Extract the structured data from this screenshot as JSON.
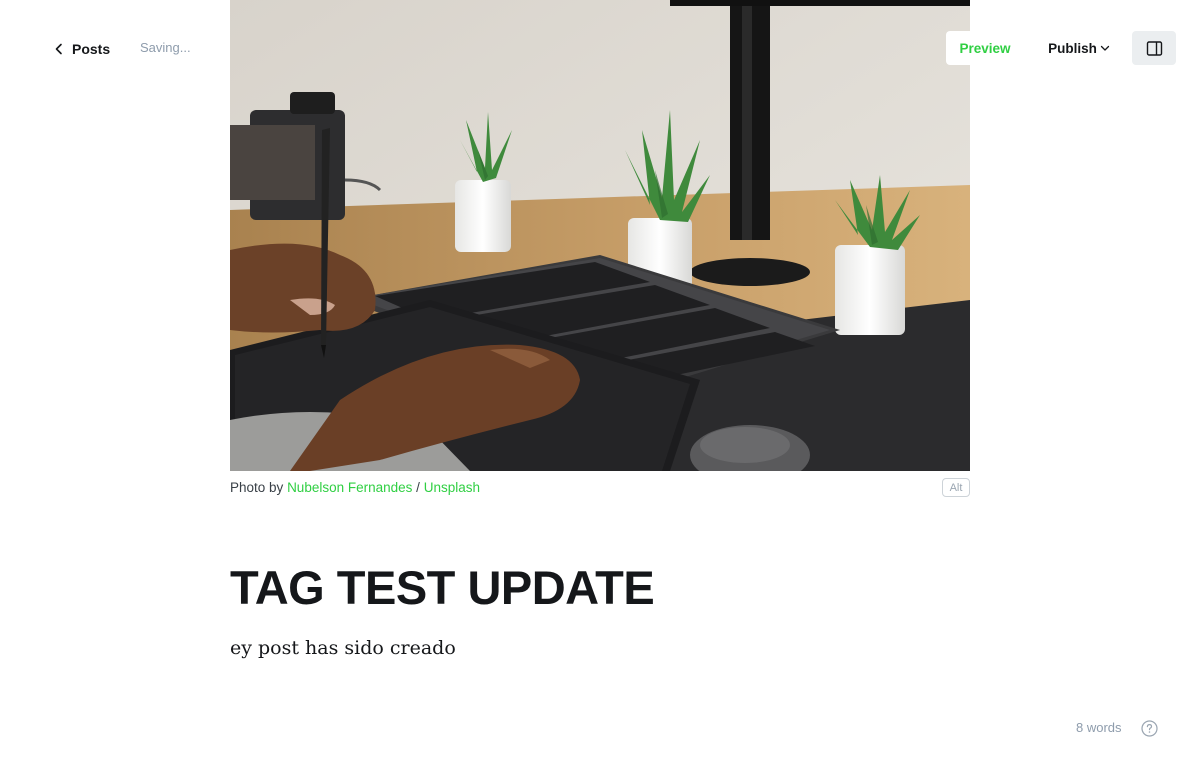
{
  "header": {
    "back_label": "Posts",
    "status": "Saving...",
    "preview_label": "Preview",
    "publish_label": "Publish"
  },
  "feature_image": {
    "caption_prefix": "Photo by",
    "author": "Nubelson Fernandes",
    "separator": "/",
    "source": "Unsplash",
    "alt_label": "Alt"
  },
  "post": {
    "title": "TAG TEST UPDATE",
    "body": "ey post has sido creado"
  },
  "footer": {
    "word_count": "8 words"
  },
  "colors": {
    "accent": "#30cf43",
    "text": "#15171a",
    "muted": "#8e9cac"
  }
}
